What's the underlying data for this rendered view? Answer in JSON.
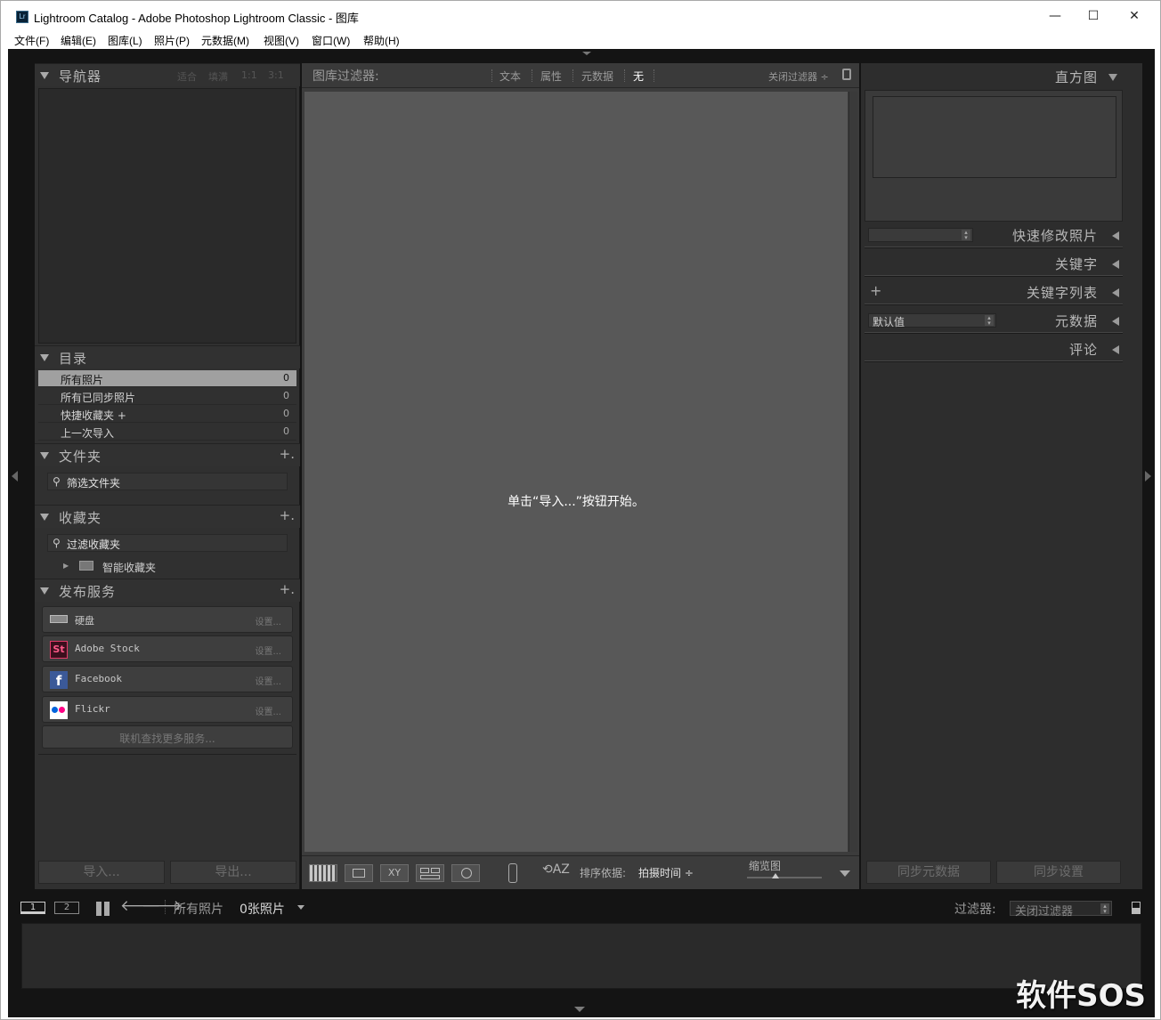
{
  "window": {
    "app_icon": "Lr",
    "title": "Lightroom Catalog - Adobe Photoshop Lightroom Classic - 图库",
    "minimize": "—",
    "maximize": "☐",
    "close": "✕"
  },
  "menubar": [
    "文件(F)",
    "编辑(E)",
    "图库(L)",
    "照片(P)",
    "元数据(M)",
    "视图(V)",
    "窗口(W)",
    "帮助(H)"
  ],
  "left": {
    "navigator": {
      "title": "导航器",
      "options": [
        "适合",
        "填满",
        "1:1",
        "3:1"
      ]
    },
    "catalog": {
      "title": "目录",
      "rows": [
        {
          "label": "所有照片",
          "count": "0"
        },
        {
          "label": "所有已同步照片",
          "count": "0"
        },
        {
          "label": "快捷收藏夹 +",
          "count": "0"
        },
        {
          "label": "上一次导入",
          "count": "0"
        }
      ]
    },
    "folders": {
      "title": "文件夹",
      "plus": "+.",
      "search": "筛选文件夹"
    },
    "collections": {
      "title": "收藏夹",
      "plus": "+.",
      "search": "过滤收藏夹",
      "smart": "智能收藏夹"
    },
    "publish": {
      "title": "发布服务",
      "plus": "+.",
      "services": [
        {
          "label": "硬盘",
          "setup": "设置..."
        },
        {
          "label": "Adobe Stock",
          "setup": "设置..."
        },
        {
          "label": "Facebook",
          "setup": "设置..."
        },
        {
          "label": "Flickr",
          "setup": "设置..."
        }
      ],
      "find_more": "联机查找更多服务..."
    },
    "import_button": "导入...",
    "export_button": "导出..."
  },
  "center": {
    "filter_bar": {
      "label": "图库过滤器:",
      "tabs": [
        "文本",
        "属性",
        "元数据",
        "无"
      ],
      "preset": "关闭过滤器 ÷"
    },
    "empty_message": "单击“导入...”按钮开始。",
    "toolbar": {
      "sort_label": "排序依据:",
      "sort_value": "拍摄时间 ÷",
      "thumb_label": "缩览图"
    }
  },
  "right": {
    "histogram": {
      "title": "直方图"
    },
    "quick_develop": {
      "title": "快速修改照片"
    },
    "keywording": {
      "title": "关键字"
    },
    "keyword_list": {
      "title": "关键字列表",
      "plus": "+"
    },
    "metadata": {
      "title": "元数据",
      "preset": "默认值"
    },
    "comments": {
      "title": "评论"
    },
    "sync_metadata_button": "同步元数据",
    "sync_settings_button": "同步设置"
  },
  "filmstrip": {
    "screen1": "1",
    "screen2": "2",
    "source": "所有照片",
    "count": "0张照片",
    "filter_label": "过滤器:",
    "filter_value": "关闭过滤器"
  },
  "watermark": "软件SOS",
  "colors": {
    "accent_selected_row": "#a0a0a0",
    "grid_bg": "#585858",
    "panel_bg": "#303030"
  }
}
